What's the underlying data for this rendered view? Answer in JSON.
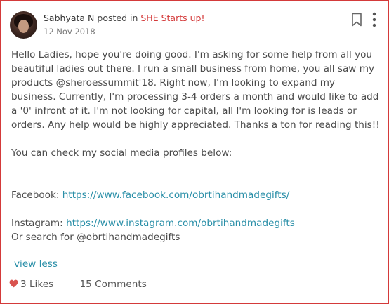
{
  "post": {
    "author": "Sabhyata N",
    "posted_in_text": "posted in",
    "group": "SHE Starts up!",
    "date": "12 Nov 2018",
    "paragraph": "Hello Ladies, hope you're doing good. I'm asking for some help from all you beautiful ladies out there. I run a small business from home, you all saw my products @sheroessummit'18. Right now, I'm looking to expand my business. Currently, I'm processing 3-4 orders a month and would like to add a '0' infront of it. I'm not looking for capital, all I'm looking for is leads or orders. Any help would be highly appreciated. Thanks a ton for reading this!!",
    "social_intro": "You can check my social media profiles below:",
    "facebook_label": "Facebook:",
    "facebook_url": "https://www.facebook.com/obrtihandmadegifts/",
    "instagram_label": "Instagram:",
    "instagram_url": "https://www.instagram.com/obrtihandmadegifts",
    "search_text": "Or search for @obrtihandmadegifts",
    "view_less": "view less"
  },
  "footer": {
    "likes": "3 Likes",
    "comments": "15 Comments"
  },
  "icons": {
    "bookmark": "bookmark-icon",
    "more": "more-vertical-icon",
    "heart": "heart-icon"
  },
  "colors": {
    "accent_red": "#d43a3a",
    "link_blue": "#2a8fa8",
    "heart": "#d9534f"
  }
}
